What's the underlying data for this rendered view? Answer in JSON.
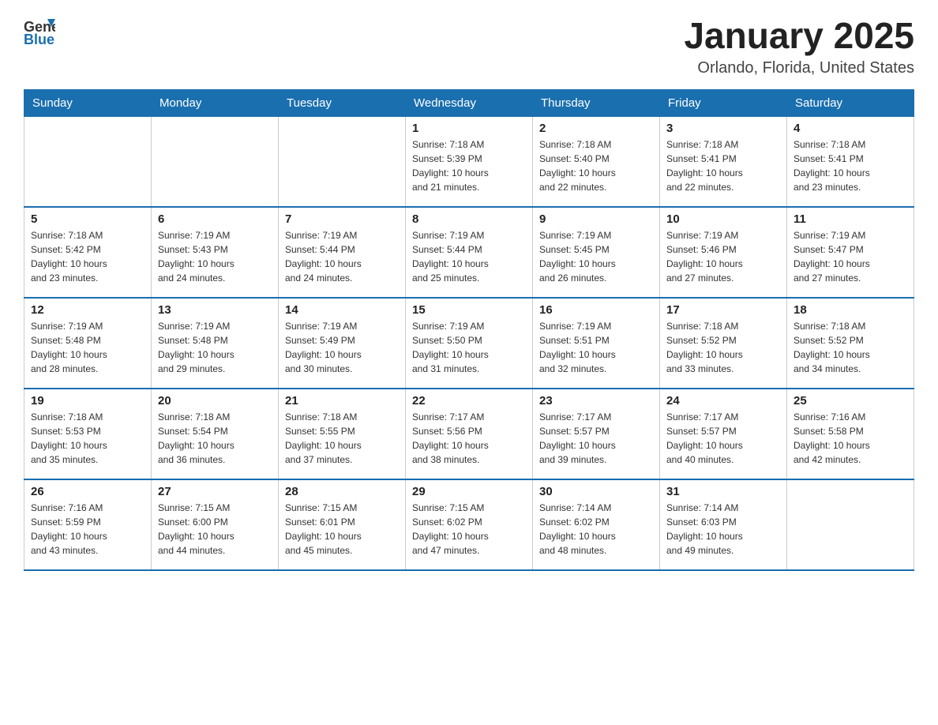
{
  "logo": {
    "general": "General",
    "blue": "Blue"
  },
  "title": "January 2025",
  "location": "Orlando, Florida, United States",
  "headers": [
    "Sunday",
    "Monday",
    "Tuesday",
    "Wednesday",
    "Thursday",
    "Friday",
    "Saturday"
  ],
  "weeks": [
    [
      {
        "day": "",
        "info": ""
      },
      {
        "day": "",
        "info": ""
      },
      {
        "day": "",
        "info": ""
      },
      {
        "day": "1",
        "info": "Sunrise: 7:18 AM\nSunset: 5:39 PM\nDaylight: 10 hours\nand 21 minutes."
      },
      {
        "day": "2",
        "info": "Sunrise: 7:18 AM\nSunset: 5:40 PM\nDaylight: 10 hours\nand 22 minutes."
      },
      {
        "day": "3",
        "info": "Sunrise: 7:18 AM\nSunset: 5:41 PM\nDaylight: 10 hours\nand 22 minutes."
      },
      {
        "day": "4",
        "info": "Sunrise: 7:18 AM\nSunset: 5:41 PM\nDaylight: 10 hours\nand 23 minutes."
      }
    ],
    [
      {
        "day": "5",
        "info": "Sunrise: 7:18 AM\nSunset: 5:42 PM\nDaylight: 10 hours\nand 23 minutes."
      },
      {
        "day": "6",
        "info": "Sunrise: 7:19 AM\nSunset: 5:43 PM\nDaylight: 10 hours\nand 24 minutes."
      },
      {
        "day": "7",
        "info": "Sunrise: 7:19 AM\nSunset: 5:44 PM\nDaylight: 10 hours\nand 24 minutes."
      },
      {
        "day": "8",
        "info": "Sunrise: 7:19 AM\nSunset: 5:44 PM\nDaylight: 10 hours\nand 25 minutes."
      },
      {
        "day": "9",
        "info": "Sunrise: 7:19 AM\nSunset: 5:45 PM\nDaylight: 10 hours\nand 26 minutes."
      },
      {
        "day": "10",
        "info": "Sunrise: 7:19 AM\nSunset: 5:46 PM\nDaylight: 10 hours\nand 27 minutes."
      },
      {
        "day": "11",
        "info": "Sunrise: 7:19 AM\nSunset: 5:47 PM\nDaylight: 10 hours\nand 27 minutes."
      }
    ],
    [
      {
        "day": "12",
        "info": "Sunrise: 7:19 AM\nSunset: 5:48 PM\nDaylight: 10 hours\nand 28 minutes."
      },
      {
        "day": "13",
        "info": "Sunrise: 7:19 AM\nSunset: 5:48 PM\nDaylight: 10 hours\nand 29 minutes."
      },
      {
        "day": "14",
        "info": "Sunrise: 7:19 AM\nSunset: 5:49 PM\nDaylight: 10 hours\nand 30 minutes."
      },
      {
        "day": "15",
        "info": "Sunrise: 7:19 AM\nSunset: 5:50 PM\nDaylight: 10 hours\nand 31 minutes."
      },
      {
        "day": "16",
        "info": "Sunrise: 7:19 AM\nSunset: 5:51 PM\nDaylight: 10 hours\nand 32 minutes."
      },
      {
        "day": "17",
        "info": "Sunrise: 7:18 AM\nSunset: 5:52 PM\nDaylight: 10 hours\nand 33 minutes."
      },
      {
        "day": "18",
        "info": "Sunrise: 7:18 AM\nSunset: 5:52 PM\nDaylight: 10 hours\nand 34 minutes."
      }
    ],
    [
      {
        "day": "19",
        "info": "Sunrise: 7:18 AM\nSunset: 5:53 PM\nDaylight: 10 hours\nand 35 minutes."
      },
      {
        "day": "20",
        "info": "Sunrise: 7:18 AM\nSunset: 5:54 PM\nDaylight: 10 hours\nand 36 minutes."
      },
      {
        "day": "21",
        "info": "Sunrise: 7:18 AM\nSunset: 5:55 PM\nDaylight: 10 hours\nand 37 minutes."
      },
      {
        "day": "22",
        "info": "Sunrise: 7:17 AM\nSunset: 5:56 PM\nDaylight: 10 hours\nand 38 minutes."
      },
      {
        "day": "23",
        "info": "Sunrise: 7:17 AM\nSunset: 5:57 PM\nDaylight: 10 hours\nand 39 minutes."
      },
      {
        "day": "24",
        "info": "Sunrise: 7:17 AM\nSunset: 5:57 PM\nDaylight: 10 hours\nand 40 minutes."
      },
      {
        "day": "25",
        "info": "Sunrise: 7:16 AM\nSunset: 5:58 PM\nDaylight: 10 hours\nand 42 minutes."
      }
    ],
    [
      {
        "day": "26",
        "info": "Sunrise: 7:16 AM\nSunset: 5:59 PM\nDaylight: 10 hours\nand 43 minutes."
      },
      {
        "day": "27",
        "info": "Sunrise: 7:15 AM\nSunset: 6:00 PM\nDaylight: 10 hours\nand 44 minutes."
      },
      {
        "day": "28",
        "info": "Sunrise: 7:15 AM\nSunset: 6:01 PM\nDaylight: 10 hours\nand 45 minutes."
      },
      {
        "day": "29",
        "info": "Sunrise: 7:15 AM\nSunset: 6:02 PM\nDaylight: 10 hours\nand 47 minutes."
      },
      {
        "day": "30",
        "info": "Sunrise: 7:14 AM\nSunset: 6:02 PM\nDaylight: 10 hours\nand 48 minutes."
      },
      {
        "day": "31",
        "info": "Sunrise: 7:14 AM\nSunset: 6:03 PM\nDaylight: 10 hours\nand 49 minutes."
      },
      {
        "day": "",
        "info": ""
      }
    ]
  ]
}
